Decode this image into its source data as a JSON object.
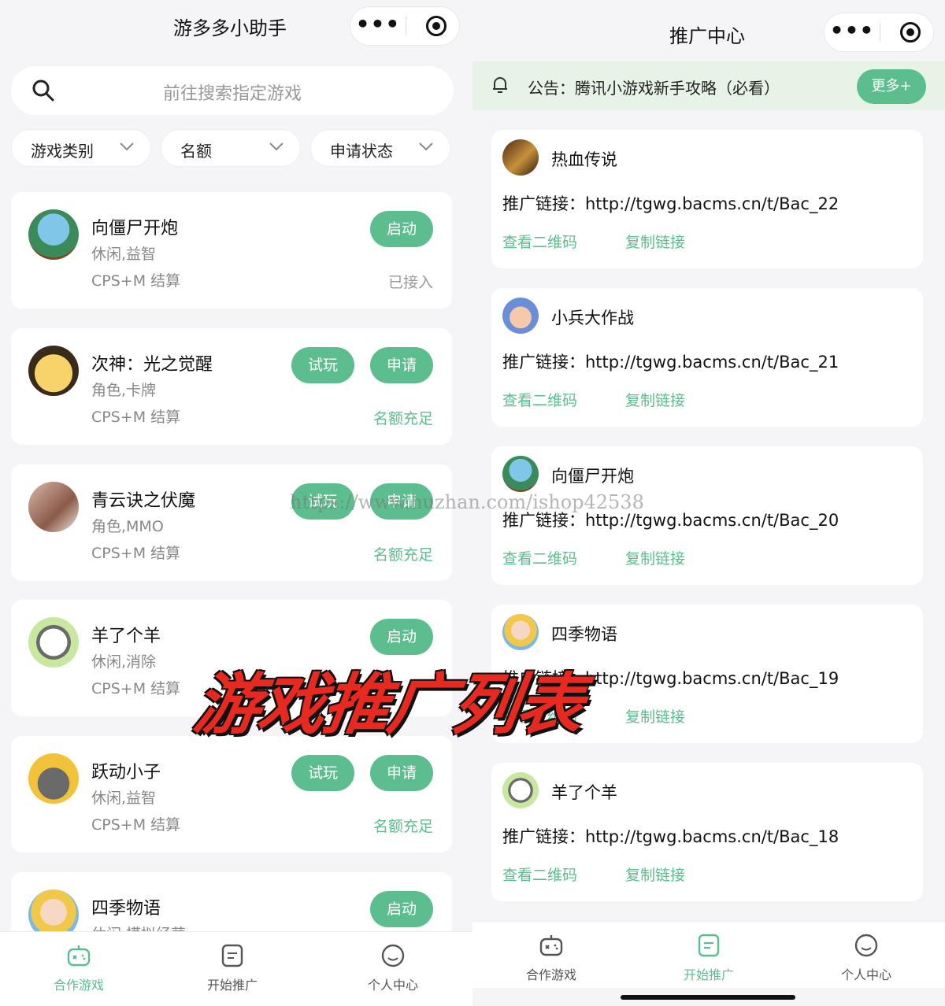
{
  "left": {
    "title": "游多多小助手",
    "search_placeholder": "前往搜索指定游戏",
    "filters": [
      {
        "label": "游戏类别"
      },
      {
        "label": "名额"
      },
      {
        "label": "申请状态"
      }
    ],
    "games": [
      {
        "name": "向僵尸开炮",
        "tags": "休闲,益智",
        "settle": "CPS+M 结算",
        "buttons": [
          "启动"
        ],
        "status": "已接入",
        "status_color": "gray"
      },
      {
        "name": "次神：光之觉醒",
        "tags": "角色,卡牌",
        "settle": "CPS+M 结算",
        "buttons": [
          "试玩",
          "申请"
        ],
        "status": "名额充足",
        "status_color": "green"
      },
      {
        "name": "青云诀之伏魔",
        "tags": "角色,MMO",
        "settle": "CPS+M 结算",
        "buttons": [
          "试玩",
          "申请"
        ],
        "status": "名额充足",
        "status_color": "green"
      },
      {
        "name": "羊了个羊",
        "tags": "休闲,消除",
        "settle": "CPS+M 结算",
        "buttons": [
          "启动"
        ],
        "status": "",
        "status_color": "gray"
      },
      {
        "name": "跃动小子",
        "tags": "休闲,益智",
        "settle": "CPS+M 结算",
        "buttons": [
          "试玩",
          "申请"
        ],
        "status": "名额充足",
        "status_color": "green"
      },
      {
        "name": "四季物语",
        "tags": "休闲,模拟经营",
        "settle": "",
        "buttons": [
          "启动"
        ],
        "status": "",
        "status_color": "gray"
      }
    ],
    "tabs": [
      {
        "label": "合作游戏",
        "icon": "gamepad-icon",
        "active": true
      },
      {
        "label": "开始推广",
        "icon": "document-icon",
        "active": false
      },
      {
        "label": "个人中心",
        "icon": "smile-icon",
        "active": false
      }
    ]
  },
  "right": {
    "title": "推广中心",
    "notice": {
      "text": "公告：腾讯小游戏新手攻略（必看）",
      "more": "更多+"
    },
    "promos": [
      {
        "name": "热血传说",
        "link_label": "推广链接：",
        "link": "http://tgwg.bacms.cn/t/Bac_22",
        "qr": "查看二维码",
        "copy": "复制链接"
      },
      {
        "name": "小兵大作战",
        "link_label": "推广链接：",
        "link": "http://tgwg.bacms.cn/t/Bac_21",
        "qr": "查看二维码",
        "copy": "复制链接"
      },
      {
        "name": "向僵尸开炮",
        "link_label": "推广链接：",
        "link": "http://tgwg.bacms.cn/t/Bac_20",
        "qr": "查看二维码",
        "copy": "复制链接"
      },
      {
        "name": "四季物语",
        "link_label": "推广链接：",
        "link": "http://tgwg.bacms.cn/t/Bac_19",
        "qr": "查看二维码",
        "copy": "复制链接"
      },
      {
        "name": "羊了个羊",
        "link_label": "推广链接：",
        "link": "http://tgwg.bacms.cn/t/Bac_18",
        "qr": "查看二维码",
        "copy": "复制链接"
      }
    ],
    "tabs": [
      {
        "label": "合作游戏",
        "icon": "gamepad-icon",
        "active": false
      },
      {
        "label": "开始推广",
        "icon": "document-icon",
        "active": true
      },
      {
        "label": "个人中心",
        "icon": "smile-icon",
        "active": false
      }
    ]
  },
  "overlay": {
    "promo_text": "游戏推广列表",
    "watermark": "https://www.huzhan.com/ishop42538"
  },
  "colors": {
    "accent": "#5cbd8e",
    "notice_bg": "#e6f3e6",
    "promo_red": "#e8291f"
  }
}
